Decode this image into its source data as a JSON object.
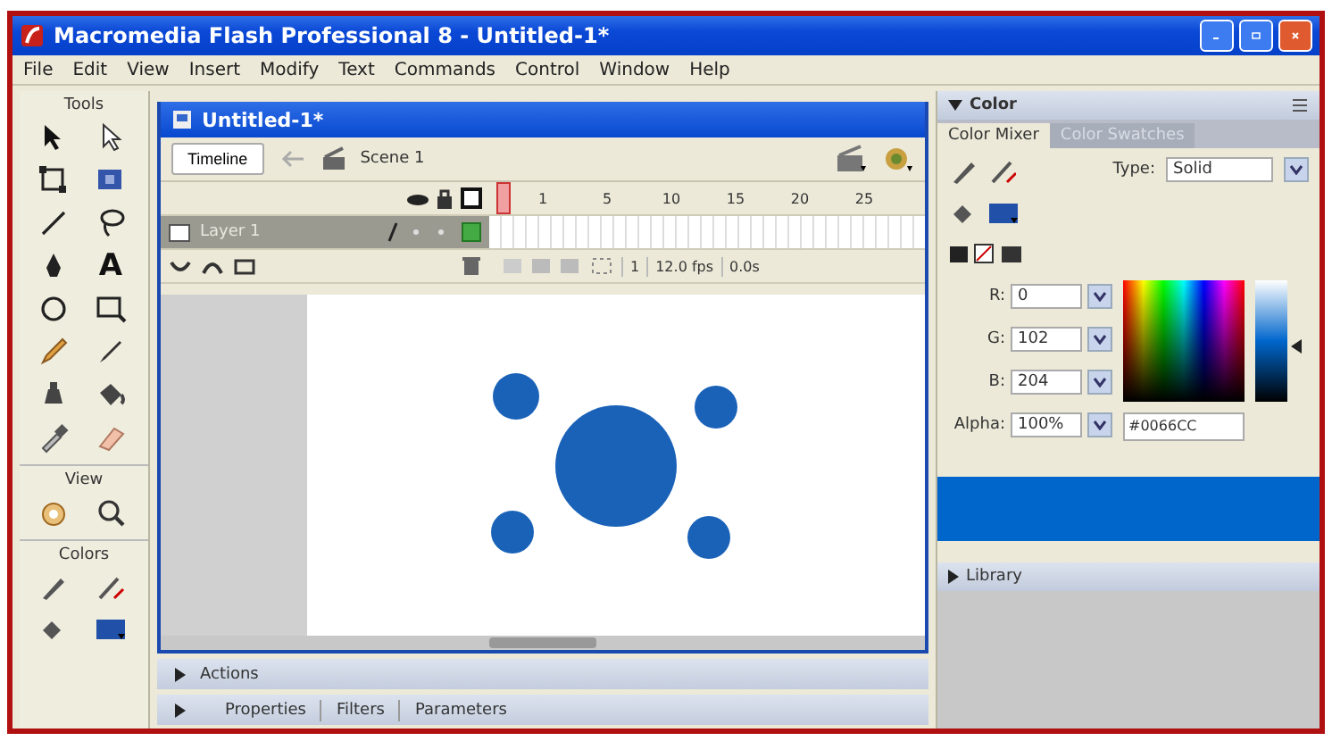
{
  "window": {
    "title": "Macromedia Flash Professional 8 - Untitled-1*"
  },
  "menu": [
    "File",
    "Edit",
    "View",
    "Insert",
    "Modify",
    "Text",
    "Commands",
    "Control",
    "Window",
    "Help"
  ],
  "tools": {
    "title": "Tools",
    "text_glyph": "A",
    "view_label": "View",
    "colors_label": "Colors"
  },
  "document": {
    "title": "Untitled-1*",
    "timeline_button": "Timeline",
    "scene": "Scene 1",
    "frame_numbers": [
      "1",
      "5",
      "10",
      "15",
      "20",
      "25"
    ],
    "layer": {
      "name": "Layer 1",
      "selected": true
    },
    "current_frame": "1",
    "frame_rate": "12.0 fps",
    "elapsed": "0.0s"
  },
  "color_panel": {
    "title": "Color",
    "tabs": [
      {
        "label": "Color Mixer",
        "selected": true
      },
      {
        "label": "Color Swatches",
        "selected": false
      }
    ],
    "type_label": "Type:",
    "type_value": "Solid",
    "fields": [
      {
        "label": "R:",
        "value": "0"
      },
      {
        "label": "G:",
        "value": "102"
      },
      {
        "label": "B:",
        "value": "204"
      },
      {
        "label": "Alpha:",
        "value": "100%"
      }
    ],
    "hex": "#0066CC",
    "brightness": {
      "level": 0.45
    }
  },
  "library": {
    "title": "Library"
  },
  "bottom_panels": {
    "actions": "Actions",
    "tabs": [
      "Properties",
      "Filters",
      "Parameters"
    ]
  }
}
